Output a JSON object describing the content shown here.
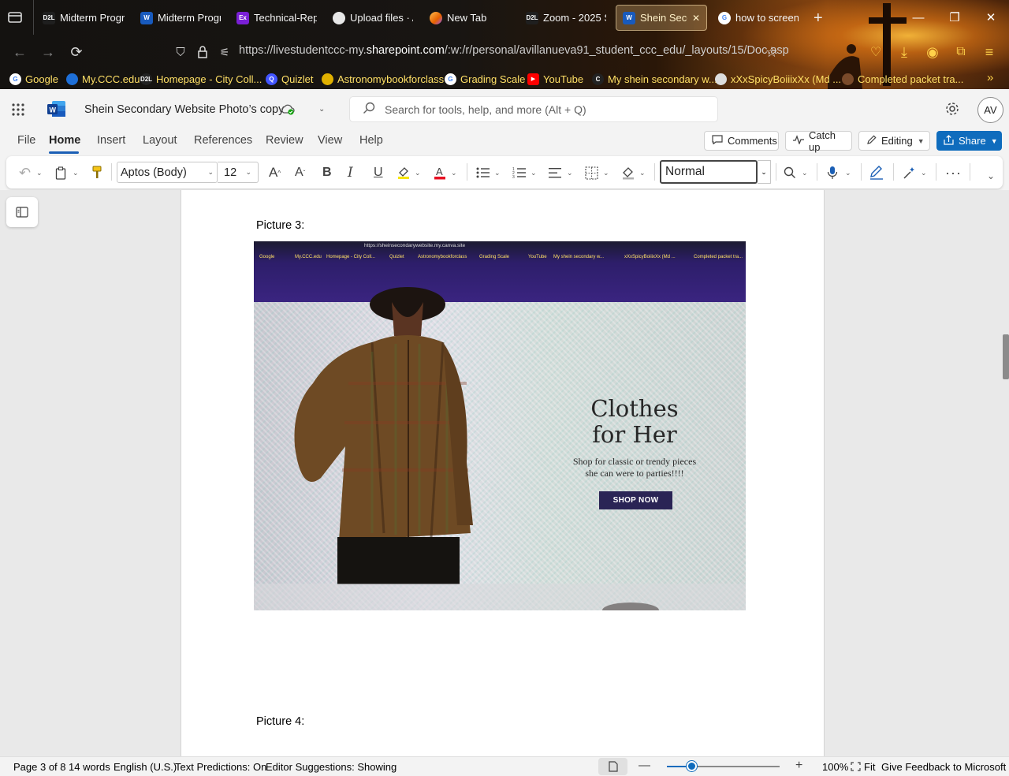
{
  "browser": {
    "tabs": [
      {
        "label": "Midterm Progr",
        "favicon": "D2L",
        "color": "#1f1f1f",
        "active": false
      },
      {
        "label": "Midterm Progr",
        "favicon": "W",
        "color": "#185abd",
        "active": false
      },
      {
        "label": "Technical-Repo",
        "favicon": "Ex",
        "color": "#7a1fd6",
        "active": false
      },
      {
        "label": "Upload files · A",
        "favicon": "github-icon",
        "color": "#333333",
        "active": false
      },
      {
        "label": "New Tab",
        "favicon": "firefox-icon",
        "color": "#e66000",
        "active": false
      },
      {
        "label": "Zoom - 2025 S",
        "favicon": "D2L",
        "color": "#1f1f1f",
        "active": false
      },
      {
        "label": "Shein Secon",
        "favicon": "W",
        "color": "#185abd",
        "active": true
      },
      {
        "label": "how to screen",
        "favicon": "G",
        "color": "#ffffff",
        "active": false
      }
    ],
    "url_prefix": "https://livestudentccc-my.",
    "url_domain": "sharepoint.com",
    "url_suffix": "/:w:/r/personal/avillanueva91_student_ccc_edu/_layouts/15/Doc.asp",
    "bookmarks": [
      {
        "label": "Google",
        "icon": "G"
      },
      {
        "label": "My.CCC.edu",
        "icon": "ccc-icon"
      },
      {
        "label": "Homepage - City Coll...",
        "icon": "D2L"
      },
      {
        "label": "Quizlet",
        "icon": "Q"
      },
      {
        "label": "Astronomybookforclass",
        "icon": "globe-icon"
      },
      {
        "label": "Grading Scale",
        "icon": "G"
      },
      {
        "label": "YouTube",
        "icon": "youtube-icon"
      },
      {
        "label": "My shein secondary w...",
        "icon": "C"
      },
      {
        "label": "xXxSpicyBoiiixXx (Md ...",
        "icon": "github-icon"
      },
      {
        "label": "Completed packet tra...",
        "icon": "folder-icon"
      }
    ]
  },
  "word": {
    "doc_title": "Shein Secondary Website Photo’s copy",
    "search_placeholder": "Search for tools, help, and more (Alt + Q)",
    "avatar": "AV",
    "menu": [
      "File",
      "Home",
      "Insert",
      "Layout",
      "References",
      "Review",
      "View",
      "Help"
    ],
    "comments_label": "Comments",
    "catchup_label": "Catch up",
    "editing_label": "Editing",
    "share_label": "Share",
    "font_name": "Aptos (Body)",
    "font_size": "12",
    "style_name": "Normal",
    "accent": "#0f6cbd"
  },
  "document": {
    "label_picture3": "Picture 3:",
    "label_picture4": "Picture 4:",
    "photo": {
      "url_text": "https://sheinsecondarywebsite.my.canva.site",
      "bookmarks_text": [
        "Google",
        "My.CCC.edu",
        "Homepage - City Coll...",
        "Quizlet",
        "Astronomybookforclass",
        "Grading Scale",
        "YouTube",
        "My shein secondary w...",
        "xXxSpicyBoiiixXx (Md ...",
        "Completed packet tra..."
      ],
      "title_line1": "Clothes",
      "title_line2": "for Her",
      "subtitle_line1": "Shop for classic or trendy pieces",
      "subtitle_line2": "she can were to parties!!!!",
      "button": "SHOP NOW"
    }
  },
  "status": {
    "page": "Page 3 of 8",
    "words": "14 words",
    "language": "English (U.S.)",
    "text_predictions": "Text Predictions: On",
    "editor_suggestions": "Editor Suggestions: Showing",
    "zoom": "100%",
    "zoom_fraction": 0.22,
    "fit": "Fit",
    "feedback": "Give Feedback to Microsoft"
  }
}
